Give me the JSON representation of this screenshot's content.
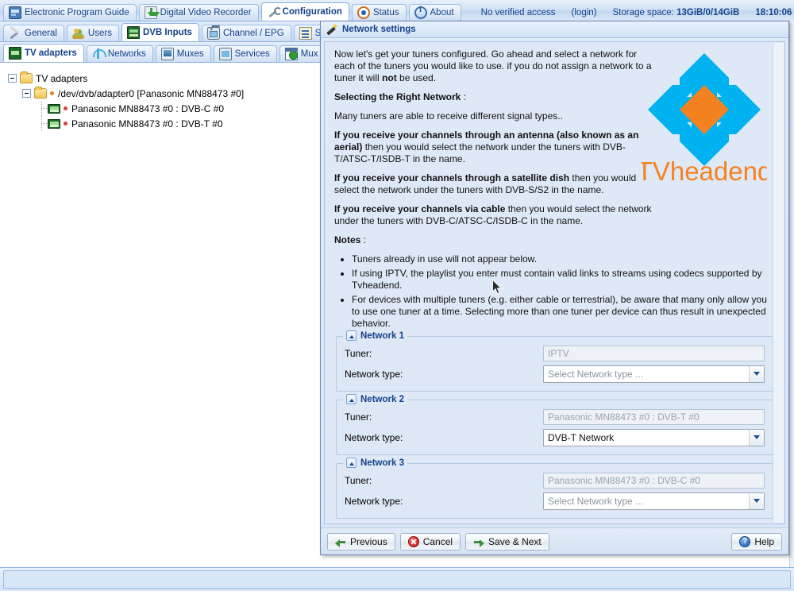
{
  "top_tabs": [
    {
      "label": "Electronic Program Guide",
      "icon": "epg-icon",
      "active": false
    },
    {
      "label": "Digital Video Recorder",
      "icon": "dvr-icon",
      "active": false
    },
    {
      "label": "Configuration",
      "icon": "wrench-icon",
      "active": true
    },
    {
      "label": "Status",
      "icon": "status-eye-icon",
      "active": false
    },
    {
      "label": "About",
      "icon": "info-icon",
      "active": false
    }
  ],
  "statusbar": {
    "access": "No verified access",
    "login": "(login)",
    "storage_label": "Storage space:",
    "storage_value": "13GiB/0/14GiB",
    "clock": "18:10:06"
  },
  "config_tabs": [
    {
      "label": "General",
      "icon": "tools-icon",
      "active": false
    },
    {
      "label": "Users",
      "icon": "users-icon",
      "active": false
    },
    {
      "label": "DVB Inputs",
      "icon": "card-icon",
      "active": true
    },
    {
      "label": "Channel / EPG",
      "icon": "tv-icon",
      "active": false
    },
    {
      "label": "Strea",
      "icon": "stream-icon",
      "active": false
    }
  ],
  "dvb_tabs": [
    {
      "label": "TV adapters",
      "icon": "tvadapter-icon",
      "active": true
    },
    {
      "label": "Networks",
      "icon": "antenna-icon",
      "active": false
    },
    {
      "label": "Muxes",
      "icon": "mux-icon",
      "active": false
    },
    {
      "label": "Services",
      "icon": "services-icon",
      "active": false
    },
    {
      "label": "Mux Sch",
      "icon": "muxsched-icon",
      "active": false
    }
  ],
  "tree": [
    {
      "label": "TV adapters",
      "depth": 0,
      "icon": "folder-icon",
      "expander": true,
      "dot": false
    },
    {
      "label": "/dev/dvb/adapter0 [Panasonic MN88473 #0]",
      "depth": 1,
      "icon": "folder-icon",
      "expander": true,
      "dot": true,
      "dot_color": "#e08030"
    },
    {
      "label": "Panasonic MN88473 #0 : DVB-C #0",
      "depth": 2,
      "icon": "card-icon",
      "expander": false,
      "dot": true,
      "dot_color": "#d14040"
    },
    {
      "label": "Panasonic MN88473 #0 : DVB-T #0",
      "depth": 2,
      "icon": "card-icon",
      "expander": false,
      "dot": true,
      "dot_color": "#d14040"
    }
  ],
  "dialog": {
    "title": "Network settings",
    "title_icon": "magic-wand-icon",
    "intro_1a": "Now let's get your tuners configured. Go ahead and select a network for each of the tuners you would like to use. if you do not assign a network to a tuner it will ",
    "intro_1b": "not",
    "intro_1c": " be used.",
    "heading_select": "Selecting the Right Network",
    "heading_select_colon": " :",
    "many_tuners": "Many tuners are able to receive different signal types..",
    "antenna_bold": "If you receive your channels through an antenna (also known as an aerial)",
    "antenna_rest": " then you would select the network under the tuners with DVB-T/ATSC-T/ISDB-T in the name.",
    "satellite_bold": "If you receive your channels through a satellite dish",
    "satellite_rest": " then you would select the network under the tuners with DVB-S/S2 in the name.",
    "cable_bold": "If you receive your channels via cable",
    "cable_rest": " then you would select the network under the tuners with DVB-C/ATSC-C/ISDB-C in the name.",
    "notes_label": "Notes",
    "notes_colon": " :",
    "notes": [
      "Tuners already in use will not appear below.",
      "If using IPTV, the playlist you enter must contain valid links to streams using codecs supported by Tvheadend.",
      "For devices with multiple tuners (e.g. either cable or terrestrial), be aware that many only allow you to use one tuner at a time. Selecting more than one tuner per device can thus result in unexpected behavior."
    ],
    "logo_text": "TVheadend",
    "logo_colors": {
      "arrow": "#00b2f0",
      "diamond": "#f58220",
      "text": "#f58220"
    },
    "field_labels": {
      "tuner": "Tuner:",
      "network_type": "Network type:"
    },
    "networks": [
      {
        "legend": "Network 1",
        "tuner_value": "IPTV",
        "network_type_value": "Select Network type ...",
        "network_type_is_placeholder": true
      },
      {
        "legend": "Network 2",
        "tuner_value": "Panasonic MN88473 #0 : DVB-T #0",
        "network_type_value": "DVB-T Network",
        "network_type_is_placeholder": false
      },
      {
        "legend": "Network 3",
        "tuner_value": "Panasonic MN88473 #0 : DVB-C #0",
        "network_type_value": "Select Network type ...",
        "network_type_is_placeholder": true
      }
    ],
    "buttons": {
      "previous": "Previous",
      "cancel": "Cancel",
      "save_next": "Save & Next",
      "help": "Help"
    }
  }
}
